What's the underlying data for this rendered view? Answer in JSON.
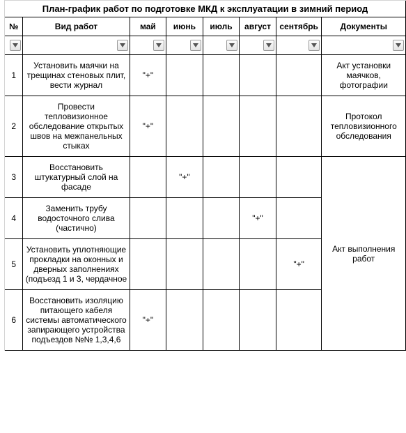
{
  "title": "План-график работ по подготовке МКД к эксплуатации в зимний период",
  "headers": {
    "num": "№",
    "work": "Вид работ",
    "may": "май",
    "jun": "июнь",
    "jul": "июль",
    "aug": "август",
    "sep": "сентябрь",
    "doc": "Документы"
  },
  "mark": "\"+\"",
  "rows": [
    {
      "num": "1",
      "work": "Установить маячки на трещинах стеновых плит, вести журнал",
      "may": true,
      "jun": false,
      "jul": false,
      "aug": false,
      "sep": false,
      "doc": "Акт установки маячков, фотографии",
      "doc_rowspan": 1
    },
    {
      "num": "2",
      "work": "Провести тепловизионное обследование открытых швов на межпанельных стыках",
      "may": true,
      "jun": false,
      "jul": false,
      "aug": false,
      "sep": false,
      "doc": "Протокол тепловизионного обследования",
      "doc_rowspan": 1
    },
    {
      "num": "3",
      "work": "Восстановить штукатурный слой на фасаде",
      "may": false,
      "jun": true,
      "jul": false,
      "aug": false,
      "sep": false,
      "doc": "Акт выполнения работ",
      "doc_rowspan": 4
    },
    {
      "num": "4",
      "work": "Заменить трубу водосточного слива (частично)",
      "may": false,
      "jun": false,
      "jul": false,
      "aug": true,
      "sep": false,
      "doc": null,
      "doc_rowspan": 0
    },
    {
      "num": "5",
      "work": "Установить уплотняющие прокладки на оконных и дверных заполнениях (подъезд 1 и 3, чердачное",
      "may": false,
      "jun": false,
      "jul": false,
      "aug": false,
      "sep": true,
      "doc": null,
      "doc_rowspan": 0
    },
    {
      "num": "6",
      "work": "Восстановить изоляцию питающего кабеля системы автоматического запирающего устройства подъездов №№ 1,3,4,6",
      "may": true,
      "jun": false,
      "jul": false,
      "aug": false,
      "sep": false,
      "doc": null,
      "doc_rowspan": 0
    }
  ]
}
